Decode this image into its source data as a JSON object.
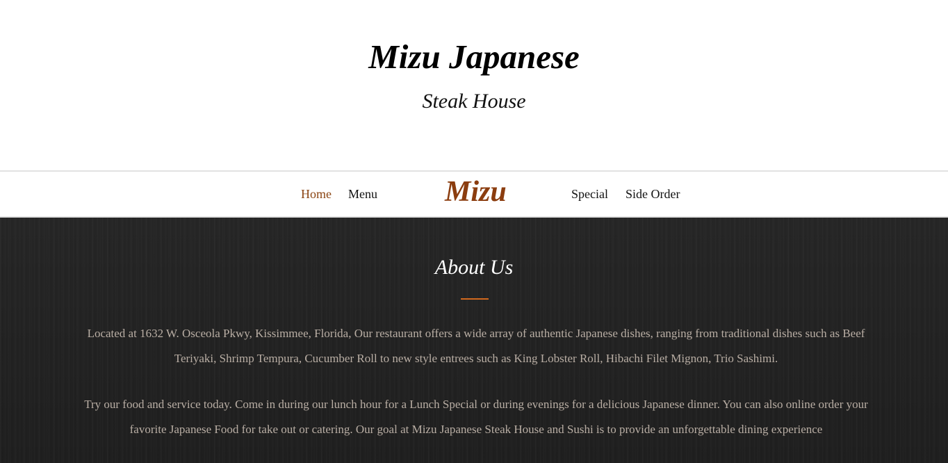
{
  "header": {
    "title": "Mizu Japanese",
    "subtitle": "Steak House"
  },
  "nav": {
    "home": "Home",
    "menu": "Menu",
    "logo": "Mizu",
    "special": "Special",
    "side_order": "Side Order",
    "active_item": "Home"
  },
  "about": {
    "heading": "About Us",
    "paragraph_1": "Located at 1632 W. Osceola Pkwy, Kissimmee, Florida, Our restaurant offers a wide array of authentic Japanese dishes, ranging from traditional dishes such as Beef Teriyaki, Shrimp Tempura, Cucumber Roll to new style entrees such as King Lobster Roll, Hibachi Filet Mignon, Trio Sashimi.",
    "paragraph_2": "Try our food and service today. Come in during our lunch hour for a Lunch Special or during evenings for a delicious Japanese dinner. You can also online order your favorite Japanese Food for take out or catering. Our goal at Mizu Japanese Steak House and Sushi is to provide an unforgettable dining experience"
  },
  "colors": {
    "accent": "#8b3d0f",
    "active_link": "#8b4513",
    "divider": "#d2691e",
    "about_background": "#232323",
    "about_text": "#b9aea4"
  }
}
